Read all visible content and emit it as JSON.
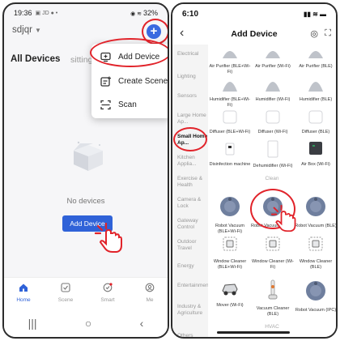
{
  "left_screen": {
    "status_bar": {
      "time": "19:36",
      "right": "32%"
    },
    "home_name": "sdjqr",
    "tabs": {
      "all_devices": "All Devices",
      "sitting": "sitting roo"
    },
    "menu": [
      {
        "label": "Add Device",
        "icon": "add-device-icon"
      },
      {
        "label": "Create Scene",
        "icon": "create-scene-icon"
      },
      {
        "label": "Scan",
        "icon": "scan-icon"
      }
    ],
    "empty_text": "No devices",
    "add_device_button": "Add Device",
    "bottom_nav": [
      "Home",
      "Scene",
      "Smart",
      "Me"
    ],
    "accent": "#2f62d8",
    "highlight_color": "#e1232a"
  },
  "right_screen": {
    "status_bar": {
      "time": "6:10"
    },
    "title": "Add Device",
    "categories": [
      "Electrical",
      "Lighting",
      "Sensors",
      "Large Home Ap...",
      "Small Home Ap...",
      "Kitchen Applia...",
      "Exercise & Health",
      "Camera & Lock",
      "Gateway Control",
      "Outdoor Travel",
      "Energy",
      "Entertainment",
      "Industry & Agriculture",
      "Others"
    ],
    "selected_category": "Small Home Ap...",
    "rows": [
      [
        "Air Purifier (BLE+Wi-Fi)",
        "Air Purifier (Wi-Fi)",
        "Air Purifier (BLE)"
      ],
      [
        "Humidifier (BLE+Wi-Fi)",
        "Humidifier (Wi-Fi)",
        "Humidifier (BLE)"
      ],
      [
        "Diffuser (BLE+Wi-Fi)",
        "Diffuser (Wi-Fi)",
        "Diffuser (BLE)"
      ],
      [
        "Disinfection machine",
        "Dehumidifier (Wi-Fi)",
        "Air Box (Wi-Fi)"
      ],
      [
        "Robot Vacuum (BLE+Wi-Fi)",
        "Robot Vacuum (Wi-Fi)",
        "Robot Vacuum (BLE)"
      ],
      [
        "Window Cleaner (BLE+Wi-Fi)",
        "Window Cleaner (Wi-Fi)",
        "Window Cleaner (BLE)"
      ],
      [
        "Mover (Wi-Fi)",
        "Vacuum Cleaner (BLE)",
        "Robot Vacuum (IPC)"
      ]
    ],
    "section_clean": "Clean",
    "section_hvac": "HVAC"
  }
}
